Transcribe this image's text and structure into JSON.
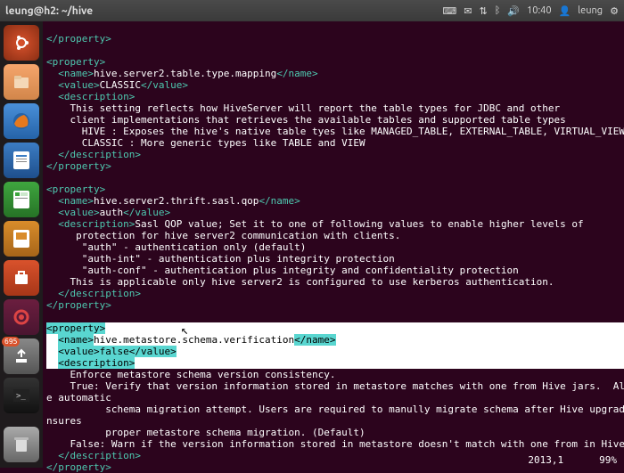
{
  "topbar": {
    "title": "leung@h2: ~/hive",
    "time": "10:40",
    "user": "leung"
  },
  "launcher": {
    "update_badge": "695"
  },
  "xml": {
    "prop1": {
      "close": "</property>",
      "open": "<property>",
      "name_open": "<name>",
      "name_val": "hive.server2.table.type.mapping",
      "name_close": "</name>",
      "value_open": "<value>",
      "value_val": "CLASSIC",
      "value_close": "</value>",
      "desc_open": "<description>",
      "desc_l1": "    This setting reflects how HiveServer will report the table types for JDBC and other",
      "desc_l2": "    client implementations that retrieves the available tables and supported table types",
      "desc_l3": "      HIVE : Exposes the hive's native table tyes like MANAGED_TABLE, EXTERNAL_TABLE, VIRTUAL_VIEW",
      "desc_l4": "      CLASSIC : More generic types like TABLE and VIEW",
      "desc_close": "</description>",
      "prop_close": "</property>"
    },
    "prop2": {
      "open": "<property>",
      "name_open": "<name>",
      "name_val": "hive.server2.thrift.sasl.qop",
      "name_close": "</name>",
      "value_open": "<value>",
      "value_val": "auth",
      "value_close": "</value>",
      "desc_open": "<description>",
      "desc_l1a": "Sasl QOP value; Set it to one of following values to enable higher levels of",
      "desc_l2": "     protection for hive server2 communication with clients.",
      "desc_l3": "      \"auth\" - authentication only (default)",
      "desc_l4": "      \"auth-int\" - authentication plus integrity protection",
      "desc_l5": "      \"auth-conf\" - authentication plus integrity and confidentiality protection",
      "desc_l6": "    This is applicable only hive server2 is configured to use kerberos authentication.",
      "desc_close": "</description>",
      "prop_close": "</property>"
    },
    "prop3": {
      "open": "<property>",
      "name_open": "<name>",
      "name_val": "hive.metastore.schema.verification",
      "name_close": "</name>",
      "value_open": "<value>",
      "value_val": "false",
      "value_close": "</value>",
      "desc_open": "<description>",
      "desc_l1": "    Enforce metastore schema version consistency.",
      "desc_l2": "    True: Verify that version information stored in metastore matches with one from Hive jars.  Also disabl",
      "desc_l2b": "e automatic",
      "desc_l3": "          schema migration attempt. Users are required to manully migrate schema after Hive upgrade which e",
      "desc_l3b": "nsures",
      "desc_l4": "          proper metastore schema migration. (Default)",
      "desc_l5": "    False: Warn if the version information stored in metastore doesn't match with one from in Hive jars.",
      "desc_close": "</description>",
      "prop_close": "</property>"
    }
  },
  "status": {
    "pos": "2013,1",
    "pct": "99%"
  }
}
